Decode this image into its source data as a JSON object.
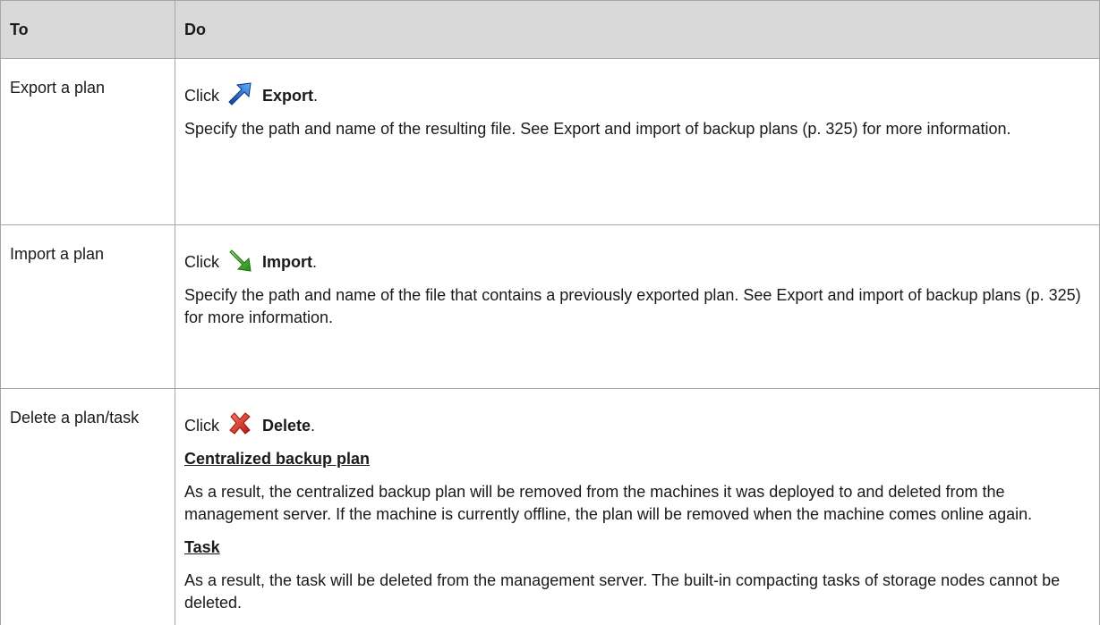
{
  "table": {
    "headers": {
      "to": "To",
      "do": "Do"
    },
    "rows": [
      {
        "to": "Export a plan",
        "click": "Click",
        "icon": "export-arrow-icon",
        "action": "Export",
        "period": ".",
        "paragraphs": [
          "Specify the path and name of the resulting file. See Export and import of backup plans (p. 325) for more information."
        ]
      },
      {
        "to": "Import a plan",
        "click": "Click",
        "icon": "import-arrow-icon",
        "action": "Import",
        "period": ".",
        "paragraphs": [
          "Specify the path and name of the file that contains a previously exported plan. See Export and import of backup plans (p. 325) for more information."
        ]
      },
      {
        "to": "Delete a plan/task",
        "click": "Click",
        "icon": "delete-x-icon",
        "action": "Delete",
        "period": ".",
        "sections": [
          {
            "heading": "Centralized backup plan",
            "text": "As a result, the centralized backup plan will be removed from the machines it was deployed to and deleted from the management server. If the machine is currently offline, the plan will be removed when the machine comes online again."
          },
          {
            "heading": "Task",
            "text": "As a result, the task will be deleted from the management server. The built-in compacting tasks of storage nodes cannot be deleted."
          }
        ]
      }
    ]
  },
  "colors": {
    "header_bg": "#d9d9d9",
    "border": "#a6a6a6",
    "export_icon": "#1f6fd1",
    "import_icon": "#3aa31f",
    "delete_icon": "#d9291c"
  }
}
